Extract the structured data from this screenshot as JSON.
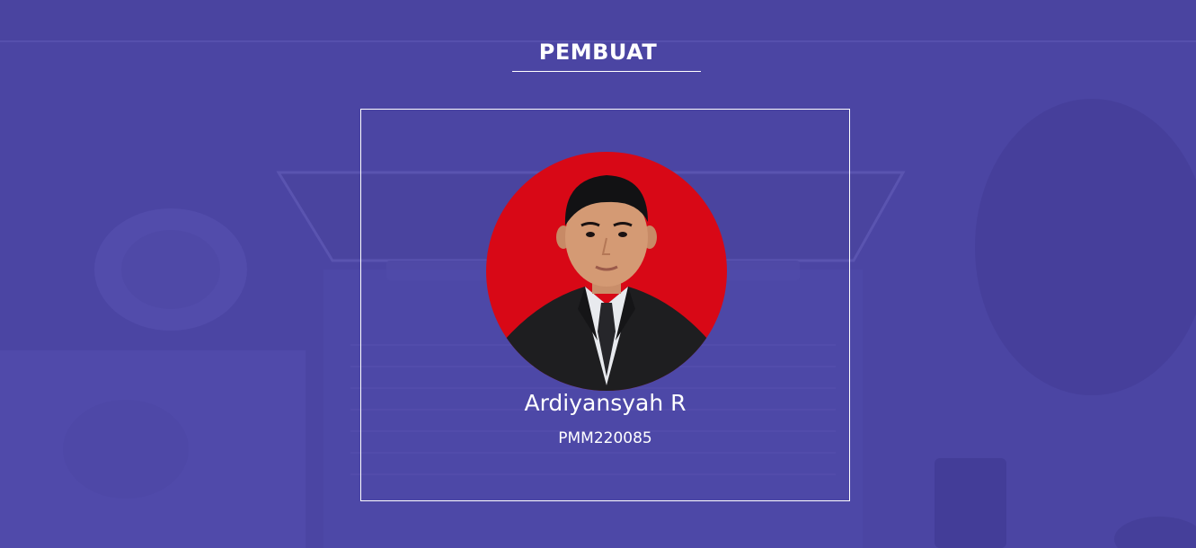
{
  "section": {
    "title": "PEMBUAT"
  },
  "profile": {
    "name": "Ardiyansyah R",
    "id": "PMM220085",
    "photo_background": "#d80816"
  },
  "colors": {
    "page_background": "#4b45a3",
    "text": "#ffffff"
  },
  "icons": {
    "avatar": "person-portrait"
  }
}
